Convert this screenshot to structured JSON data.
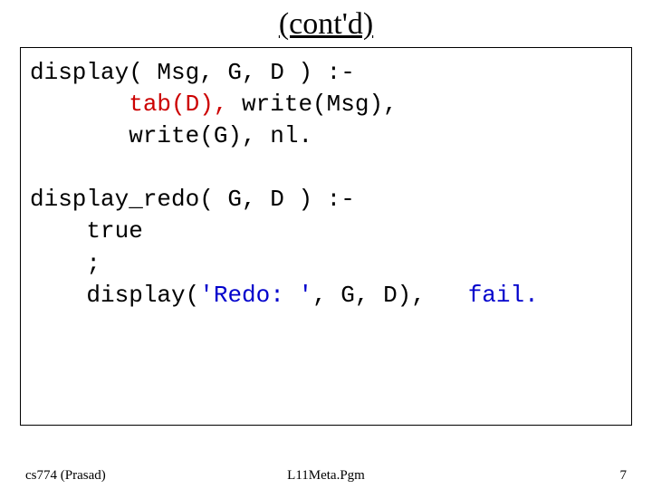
{
  "title": "(cont'd)",
  "code": {
    "l1_head": "display( Msg, G, D ) :-",
    "l2_tab": "       tab(D), ",
    "l2_wmsg": "write(Msg),",
    "l3_wg": "       write(G), nl.",
    "blank": " ",
    "l4_head2": "display_redo( G, D ) :-",
    "l5_true": "    true",
    "l6_semi": "    ;",
    "l7_disp": "    display(",
    "l7_redo": "'Redo: '",
    "l7_rest": ", G, D),   ",
    "l7_fail": "fail."
  },
  "footer": {
    "left": "cs774 (Prasad)",
    "center": "L11Meta.Pgm",
    "right": "7"
  }
}
